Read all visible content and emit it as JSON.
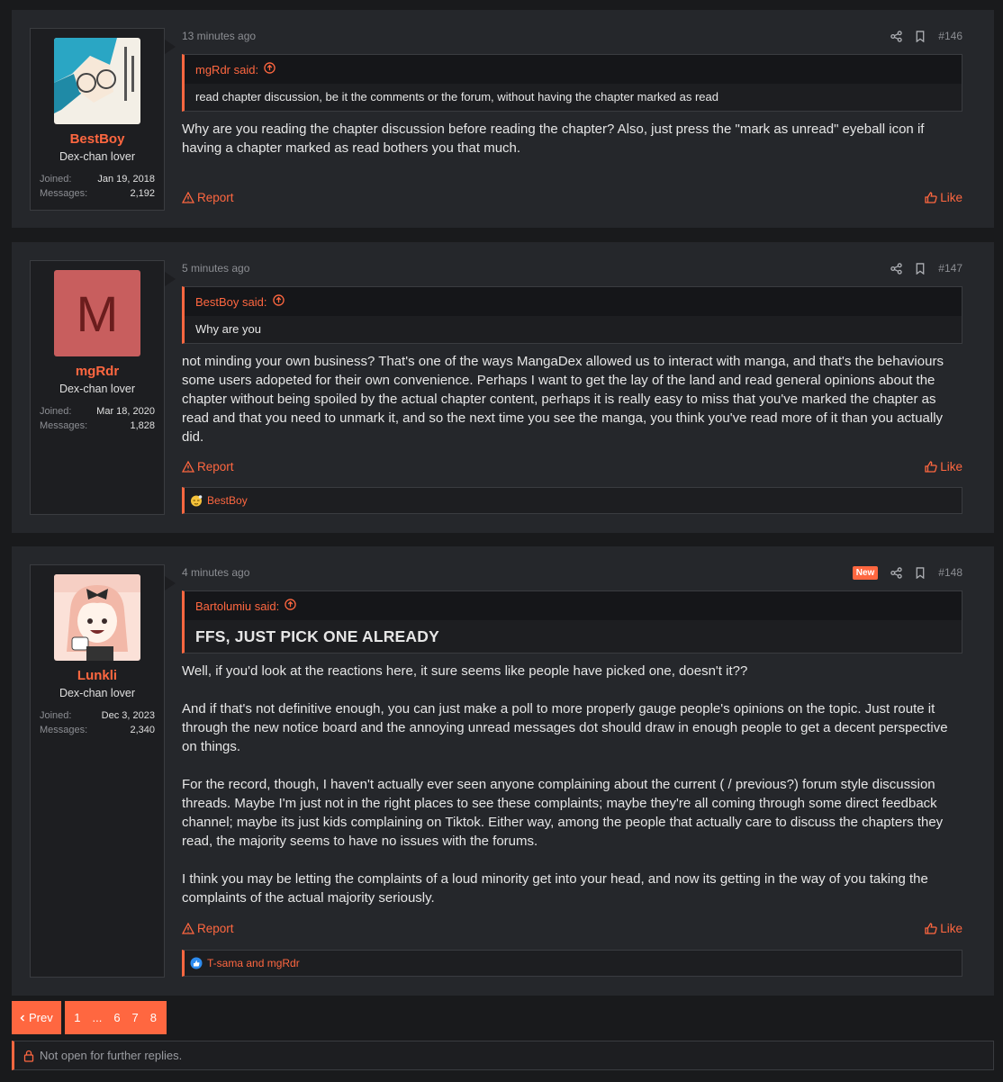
{
  "posts": [
    {
      "user": {
        "name": "BestBoy",
        "title": "Dex-chan lover",
        "joined_label": "Joined:",
        "joined": "Jan 19, 2018",
        "messages_label": "Messages:",
        "messages": "2,192"
      },
      "time": "13 minutes ago",
      "number": "#146",
      "quote": {
        "author": "mgRdr said:",
        "text": "read chapter discussion, be it the comments or the forum, without having the chapter marked as read"
      },
      "body": [
        "Why are you reading the chapter discussion before reading the chapter? Also, just press the \"mark as unread\" eyeball icon if having a chapter marked as read bothers you that much."
      ],
      "report": "Report",
      "like": "Like"
    },
    {
      "user": {
        "name": "mgRdr",
        "initial": "M",
        "title": "Dex-chan lover",
        "joined_label": "Joined:",
        "joined": "Mar 18, 2020",
        "messages_label": "Messages:",
        "messages": "1,828"
      },
      "time": "5 minutes ago",
      "number": "#147",
      "quote": {
        "author": "BestBoy said:",
        "text": "Why are you"
      },
      "body": [
        "not minding your own business? That's one of the ways MangaDex allowed us to interact with manga, and that's the behaviours some users adopeted for their own convenience. Perhaps I want to get the lay of the land and read general opinions about the chapter without being spoiled by the actual chapter content, perhaps it is really easy to miss that you've marked the chapter as read and that you need to unmark it, and so the next time you see the manga, you think you've read more of it than you actually did."
      ],
      "report": "Report",
      "like": "Like",
      "reactions": "BestBoy"
    },
    {
      "user": {
        "name": "Lunkli",
        "title": "Dex-chan lover",
        "joined_label": "Joined:",
        "joined": "Dec 3, 2023",
        "messages_label": "Messages:",
        "messages": "2,340"
      },
      "time": "4 minutes ago",
      "badge": "New",
      "number": "#148",
      "quote": {
        "author": "Bartolumiu said:",
        "text": "FFS, JUST PICK ONE ALREADY"
      },
      "body": [
        "Well, if you'd look at the reactions here, it sure seems like people have picked one, doesn't it??",
        "And if that's not definitive enough, you can just make a poll to more properly gauge people's opinions on the topic. Just route it through the new notice board and the annoying unread messages dot should draw in enough people to get a decent perspective on things.",
        "For the record, though, I haven't actually ever seen anyone complaining about the current ( / previous?) forum style discussion threads. Maybe I'm just not in the right places to see these complaints; maybe they're all coming through some direct feedback channel; maybe its just kids complaining on Tiktok. Either way, among the people that actually care to discuss the chapters they read, the majority seems to have no issues with the forums.",
        "I think you may be letting the complaints of a loud minority get into your head, and now its getting in the way of you taking the complaints of the actual majority seriously."
      ],
      "report": "Report",
      "like": "Like",
      "reactions": "T-sama and mgRdr"
    }
  ],
  "pagination": {
    "prev": "Prev",
    "pages": [
      "1",
      "...",
      "6",
      "7",
      "8"
    ]
  },
  "closed_notice": "Not open for further replies.",
  "colors": {
    "accent": "#ff6740",
    "post_bg": "#25272b",
    "page_bg": "#191a1c",
    "user_bg": "#1d1e21",
    "letter_avatar_bg": "#c85e5e"
  },
  "icons": [
    "share-icon",
    "bookmark-icon",
    "arrow-up-circle-icon",
    "warning-icon",
    "thumbs-up-icon",
    "lock-icon",
    "chevron-left-icon",
    "sleepy-emoji-icon",
    "like-reaction-icon"
  ]
}
